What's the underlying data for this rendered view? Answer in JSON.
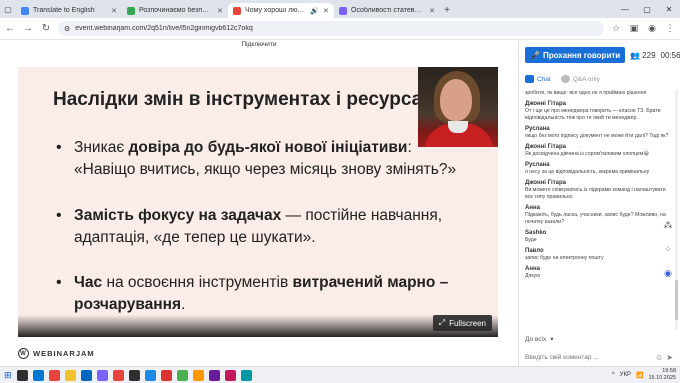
{
  "browser": {
    "tabs": [
      {
        "label": "Translate to English",
        "color": "#4285f4",
        "active": false
      },
      {
        "label": "Розпочинаємо безплатні",
        "color": "#34a853",
        "active": false
      },
      {
        "label": "Чому хороші люди створ",
        "color": "#e8443a",
        "active": true
      },
      {
        "label": "Особливості статево рольов",
        "color": "#7b61ff",
        "active": false
      }
    ],
    "url": "event.webinarjam.com/2q51n/live/l5n2ginmigvb612c7okq"
  },
  "connect_label": "Підключити",
  "slide": {
    "title": "Наслідки змін в інструментах і ресурсах",
    "bullets": [
      {
        "pre": "Зникає ",
        "bold": "довіра до будь-якої нової ініціативи",
        "post": ": «Навіщо вчитись, якщо через місяць знову змінять?»"
      },
      {
        "pre": "",
        "bold": "Замість фокусу на задачах",
        "post": " — постійне навчання, адаптація, «де тепер це шукати»."
      },
      {
        "pre": "",
        "bold": "Час",
        "post": " на освоєння інструментів ",
        "bold2": "витрачений марно – розчарування",
        "post2": "."
      }
    ]
  },
  "fullscreen_label": "Fullscreen",
  "logo_text": "WEBINARJAM",
  "panel": {
    "cta_label": "Прохання говорити",
    "attendees": "229",
    "timer": "00:56:58",
    "tabs": {
      "chat": "Chat",
      "qa": "Q&A only"
    },
    "messages": [
      {
        "author": "",
        "text": "зробити, як вище: все одно не я приймаю рішення"
      },
      {
        "author": "Джонні Гітара",
        "text": "От і ще це про менеджера говорить — класне ТЗ. Брати відповідальність теж про те який ти менеджер."
      },
      {
        "author": "Руслана",
        "text": "якщо без мого підпису документ не може йти далі? Тоді як?"
      },
      {
        "author": "Джонні Гітара",
        "text": "Як досвідчена дівчина із сором'язливим хлопцем😄"
      },
      {
        "author": "Руслана",
        "text": "я несу за це відповідальність, зокрема кримінальну"
      },
      {
        "author": "Джонні Гітара",
        "text": "Ви можете співкуватись із лідерами команд і налаштувати все типу правильно."
      },
      {
        "author": "Анна",
        "text": "Підкажіть, будь ласка, учасники, запис буде? Можливо, на початку казали?"
      },
      {
        "author": "Sashko",
        "text": "Буде"
      },
      {
        "author": "Павло",
        "text": "запис буде на електронну пошту"
      },
      {
        "author": "Анна",
        "text": "Дякую"
      }
    ],
    "to_label": "До всіх",
    "input_placeholder": "Введіть свій коментар ..."
  },
  "taskbar": {
    "lang": "УКР",
    "time": "19:58",
    "date": "15.10.2025",
    "apps": [
      "#0b5ed7",
      "#2f2f2f",
      "#0078d4",
      "#e8443a",
      "#f2c12e",
      "#0067c0",
      "#7b61ff",
      "#e8443a",
      "#2f2f2f",
      "#0078d4",
      "#1e88e5",
      "#d33",
      "#4caf50",
      "#ff9800",
      "#6a1b9a",
      "#c2185b",
      "#0097a7"
    ]
  }
}
